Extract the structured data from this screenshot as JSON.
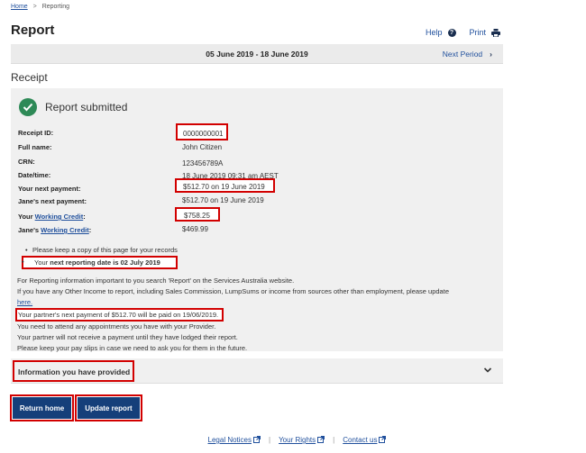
{
  "breadcrumb": {
    "home": "Home",
    "separator": ">",
    "current": "Reporting"
  },
  "page": {
    "title": "Report"
  },
  "actions": {
    "help": "Help",
    "print": "Print"
  },
  "period": {
    "dates": "05 June 2019 - 18 June 2019",
    "next": "Next Period"
  },
  "section_title": "Receipt",
  "receipt": {
    "status": "Report submitted",
    "fields": [
      {
        "label": "Receipt ID:",
        "value": "0000000001"
      },
      {
        "label": "Full name:",
        "value": "John Citizen"
      },
      {
        "label": "CRN:",
        "value": "123456789A"
      },
      {
        "label": "Date/time:",
        "value": "18 June 2019 09:31 am AEST"
      },
      {
        "label": "Your next payment:",
        "value": "$512.70 on 19 June 2019"
      },
      {
        "label": "Jane's next payment:",
        "value": "$512.70 on 19 June 2019"
      },
      {
        "label_prefix": "Your ",
        "label_link": "Working Credit",
        "label_suffix": ":",
        "value": "$758.25"
      },
      {
        "label_prefix": "Jane's ",
        "label_link": "Working Credit",
        "label_suffix": ":",
        "value": "$469.99"
      }
    ],
    "bullets": {
      "first": "Please keep a copy of this page for your records",
      "second_prefix": "Your ",
      "second_bold": "next reporting date is 02 July 2019"
    },
    "notes": {
      "line1": "For Reporting information important to you search 'Report' on the Services Australia website.",
      "line2": "If you have any Other Income to report, including Sales Commission, LumpSums or income from sources other than employment, please update",
      "link": "here.",
      "partner": "Your partner's next payment of $512.70 will be paid on 19/06/2019.",
      "line4": "You need to attend any appointments you have with your Provider.",
      "line5": "Your partner will not receive a payment until they have lodged their report.",
      "line6": "Please keep your pay slips in case we need to ask you for them in the future."
    }
  },
  "accordion": {
    "title": "Information you have provided"
  },
  "buttons": {
    "return_home": "Return home",
    "update_report": "Update report"
  },
  "footer": {
    "legal": "Legal Notices",
    "rights": "Your Rights",
    "contact": "Contact us",
    "separator": "|"
  },
  "colors": {
    "primary": "#153f7a",
    "link": "#1f4f9c",
    "success": "#2e8a57",
    "highlight": "#d20000"
  },
  "icons": [
    "help-icon",
    "print-icon",
    "chevron-right-icon",
    "check-circle-icon",
    "chevron-down-icon",
    "external-link-icon"
  ]
}
